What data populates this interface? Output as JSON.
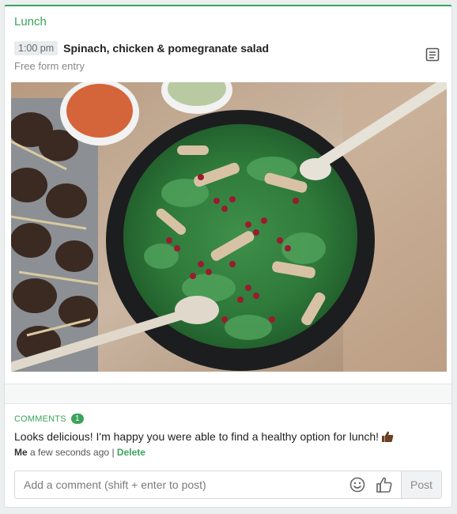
{
  "meal": {
    "label": "Lunch"
  },
  "entry": {
    "time": "1:00 pm",
    "title": "Spinach, chicken & pomegranate salad",
    "subtitle": "Free form entry"
  },
  "comments": {
    "label": "COMMENTS",
    "count": "1",
    "items": [
      {
        "text": "Looks delicious! I'm happy you were able to find a healthy option for lunch!",
        "author": "Me",
        "time": "a few seconds ago",
        "separator": "|",
        "delete_label": "Delete"
      }
    ]
  },
  "composer": {
    "placeholder": "Add a comment (shift + enter to post)",
    "post_label": "Post"
  },
  "icons": {
    "notes": "notes-icon",
    "emoji": "smiley-icon",
    "like": "thumbs-up-icon",
    "reaction": "thumbs-up-emoji"
  },
  "colors": {
    "accent": "#3aa35b"
  }
}
